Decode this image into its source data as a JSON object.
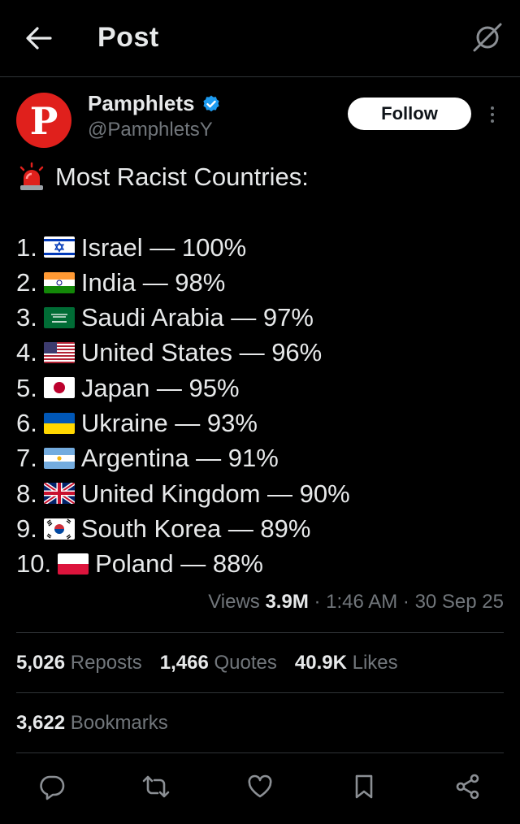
{
  "header": {
    "title": "Post"
  },
  "author": {
    "name": "Pamphlets",
    "handle": "@PamphletsY",
    "avatar_letter": "P"
  },
  "follow_label": "Follow",
  "post": {
    "heading": "Most Racist Countries:",
    "items": [
      {
        "number": "1.",
        "flag": "israel-flag",
        "text": "Israel — 100%"
      },
      {
        "number": "2.",
        "flag": "india-flag",
        "text": "India — 98%"
      },
      {
        "number": "3.",
        "flag": "saudi-arabia-flag",
        "text": "Saudi Arabia — 97%"
      },
      {
        "number": "4.",
        "flag": "united-states-flag",
        "text": "United States — 96%"
      },
      {
        "number": "5.",
        "flag": "japan-flag",
        "text": "Japan — 95%"
      },
      {
        "number": "6.",
        "flag": "ukraine-flag",
        "text": "Ukraine — 93%"
      },
      {
        "number": "7.",
        "flag": "argentina-flag",
        "text": "Argentina — 91%"
      },
      {
        "number": "8.",
        "flag": "united-kingdom-flag",
        "text": "United Kingdom — 90%"
      },
      {
        "number": "9.",
        "flag": "south-korea-flag",
        "text": "South Korea — 89%"
      },
      {
        "number": "10.",
        "flag": "poland-flag",
        "text": "Poland — 88%"
      }
    ]
  },
  "meta": {
    "views_label": "Views",
    "views_count": "3.9M",
    "time": "1:46 AM",
    "date": "30 Sep 25",
    "separator": "·"
  },
  "stats": {
    "reposts_count": "5,026",
    "reposts_label": "Reposts",
    "quotes_count": "1,466",
    "quotes_label": "Quotes",
    "likes_count": "40.9K",
    "likes_label": "Likes",
    "bookmarks_count": "3,622",
    "bookmarks_label": "Bookmarks"
  },
  "colors": {
    "background": "#000000",
    "text": "#e7e9ea",
    "muted": "#71767b",
    "divider": "#2f3336",
    "verified": "#1d9bf0",
    "avatar": "#e0201c"
  },
  "icons": [
    "back-arrow-icon",
    "grok-icon",
    "verified-badge-icon",
    "siren-icon",
    "more-icon",
    "reply-icon",
    "repost-icon",
    "like-icon",
    "bookmark-icon",
    "share-icon"
  ]
}
